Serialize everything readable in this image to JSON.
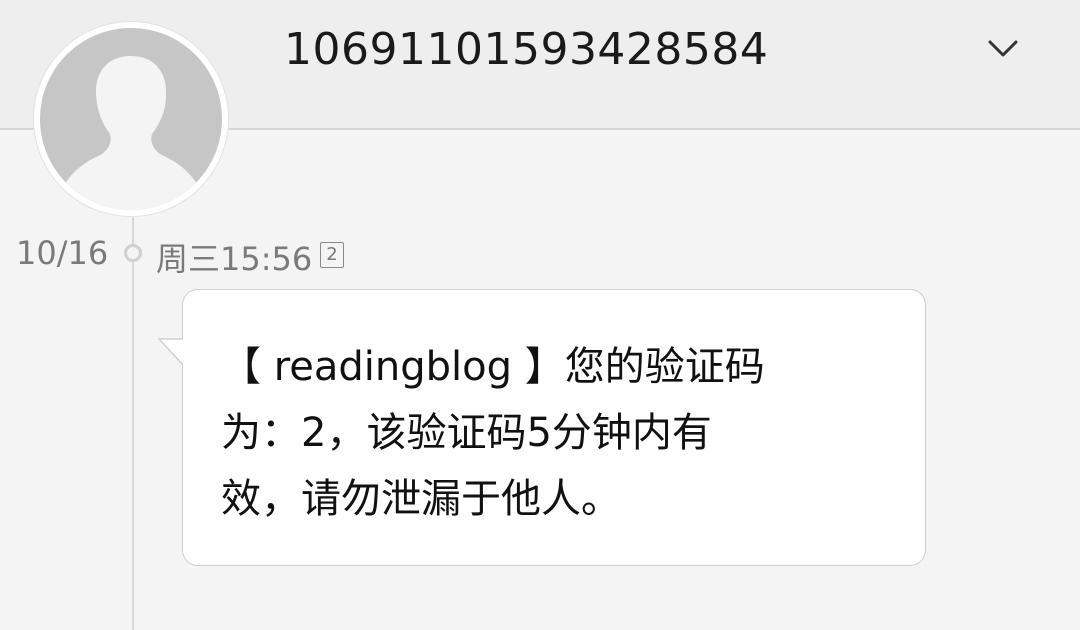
{
  "header": {
    "sender": "10691101593428584",
    "expand_icon": "chevron-down-icon"
  },
  "avatar": {
    "icon": "person-silhouette-icon"
  },
  "thread": {
    "date": "10/16",
    "time": "周三15:56",
    "sim_badge": "2"
  },
  "message": {
    "line1": "【 readingblog 】您的验证码",
    "line2": "为：2，该验证码5分钟内有",
    "line3": "效，请勿泄漏于他人。"
  }
}
